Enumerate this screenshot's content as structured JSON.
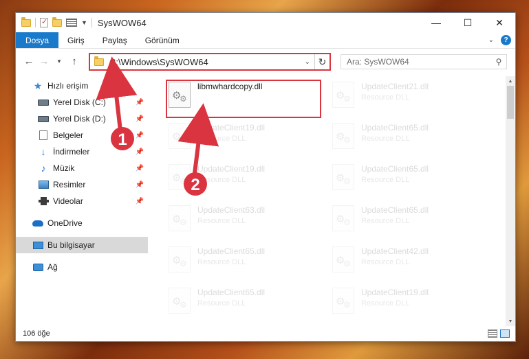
{
  "titlebar": {
    "title": "SysWOW64",
    "minimize": "—",
    "maximize": "☐",
    "close": "✕"
  },
  "ribbon": {
    "tabs": [
      "Dosya",
      "Giriş",
      "Paylaş",
      "Görünüm"
    ],
    "help": "?"
  },
  "address": {
    "path": "C:\\Windows\\SysWOW64",
    "search_placeholder": "Ara: SysWOW64"
  },
  "nav": {
    "quick_access": "Hızlı erişim",
    "items": [
      "Yerel Disk (C:)",
      "Yerel Disk (D:)",
      "Belgeler",
      "İndirmeler",
      "Müzik",
      "Resimler",
      "Videolar"
    ],
    "onedrive": "OneDrive",
    "this_pc": "Bu bilgisayar",
    "network": "Ağ"
  },
  "files": {
    "highlighted": {
      "name": "libmwhardcopy.dll"
    },
    "left_column": [
      {
        "name": "UpdateClient19.dll",
        "type": "Resource DLL"
      },
      {
        "name": "UpdateClient19.dll",
        "type": "Resource DLL"
      },
      {
        "name": "UpdateClient63.dll",
        "type": "Resource DLL"
      },
      {
        "name": "UpdateClient65.dll",
        "type": "Resource DLL"
      },
      {
        "name": "UpdateClient65.dll",
        "type": "Resource DLL"
      }
    ],
    "right_column": [
      {
        "name": "UpdateClient21.dll",
        "type": "Resource DLL"
      },
      {
        "name": "UpdateClient65.dll",
        "type": "Resource DLL"
      },
      {
        "name": "UpdateClient65.dll",
        "type": "Resource DLL"
      },
      {
        "name": "UpdateClient65.dll",
        "type": "Resource DLL"
      },
      {
        "name": "UpdateClient42.dll",
        "type": "Resource DLL"
      },
      {
        "name": "UpdateClient19.dll",
        "type": "Resource DLL"
      }
    ]
  },
  "status": {
    "count": "106 öğe"
  },
  "annotations": {
    "step1": "1",
    "step2": "2",
    "arrow_color": "#d9343f"
  }
}
